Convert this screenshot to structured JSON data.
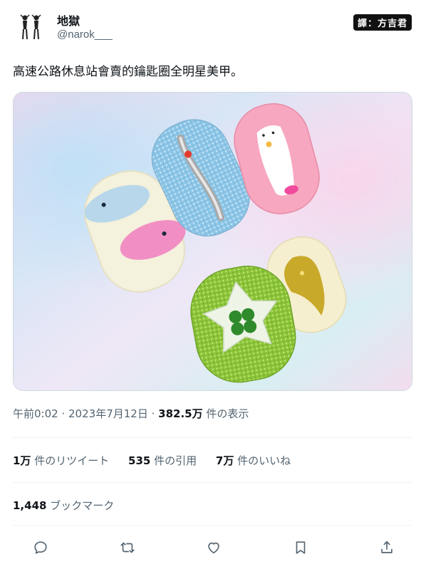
{
  "user": {
    "name": "地獄",
    "handle": "@narok___"
  },
  "translator_badge": "譯：方吉君",
  "tweet": {
    "text": "高速公路休息站會賣的鑰匙圈全明星美甲。",
    "media_description": "nail tips photo"
  },
  "meta": {
    "time": "午前0:02",
    "date": "2023年7月12日",
    "views": "382.5万",
    "views_label": "件の表示"
  },
  "stats": {
    "retweets_count": "1万",
    "retweets_label": "件のリツイート",
    "quotes_count": "535",
    "quotes_label": "件の引用",
    "likes_count": "7万",
    "likes_label": "件のいいね"
  },
  "bookmarks": {
    "count": "1,448",
    "label": "ブックマーク"
  },
  "actions": {
    "icons": [
      "reply-icon",
      "retweet-icon",
      "like-icon",
      "bookmark-icon",
      "share-icon"
    ]
  },
  "colors": {
    "text_primary": "#0f1419",
    "text_secondary": "#536471",
    "divider": "#eff3f4"
  }
}
